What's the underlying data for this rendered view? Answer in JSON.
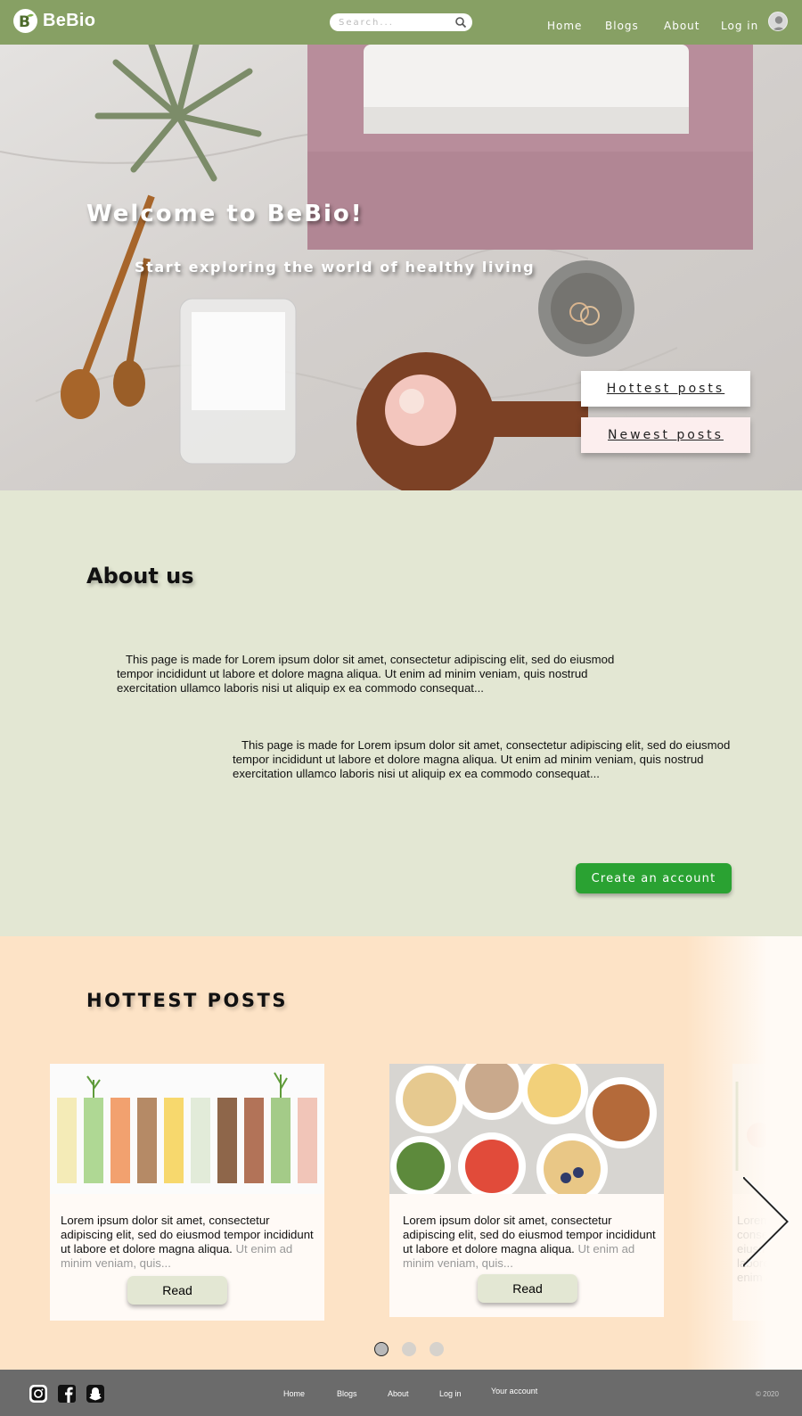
{
  "navbar": {
    "brand": "BeBio",
    "search_placeholder": "Search...",
    "links": [
      "Home",
      "Blogs",
      "About",
      "Log in"
    ],
    "icons": {
      "search": "search-icon",
      "avatar": "user-avatar-icon",
      "logo": "bebio-logo-icon"
    }
  },
  "hero": {
    "title": "Welcome to BeBio!",
    "subtitle": "Start exploring the world of healthy living",
    "buttons": {
      "hottest": "Hottest posts",
      "newest": "Newest posts"
    }
  },
  "about": {
    "title": "About us",
    "paragraphs": [
      "This page is made for Lorem ipsum dolor sit amet, consectetur adipiscing elit, sed do eiusmod tempor incididunt ut labore et dolore magna aliqua. Ut enim ad minim veniam, quis nostrud exercitation ullamco laboris nisi ut aliquip ex ea commodo consequat...",
      "This page is made for Lorem ipsum dolor sit amet, consectetur adipiscing elit, sed do eiusmod tempor incididunt ut labore et dolore magna aliqua. Ut enim ad minim veniam, quis nostrud exercitation ullamco laboris nisi ut aliquip ex ea commodo consequat..."
    ],
    "cta": "Create an account"
  },
  "hottest": {
    "title": "HOTTEST POSTS",
    "posts": [
      {
        "text": "Lorem ipsum dolor sit amet, consectetur adipiscing elit, sed do eiusmod tempor incididunt ut labore et dolore magna aliqua.",
        "faded": "Ut enim ad minim veniam, quis...",
        "button": "Read"
      },
      {
        "text": "Lorem ipsum dolor sit amet, consectetur adipiscing elit, sed do eiusmod tempor incididunt ut labore et dolore magna aliqua.",
        "faded": "Ut enim ad minim veniam, quis...",
        "button": "Read"
      },
      {
        "text": "Lorem consect eiusmo labore e enim ad"
      }
    ],
    "active_page": 1,
    "page_count": 3
  },
  "footer": {
    "links": [
      "Home",
      "Blogs",
      "About",
      "Log in",
      "Your account"
    ],
    "copyright": "© 2020",
    "social": [
      "instagram-icon",
      "facebook-icon",
      "snapchat-icon"
    ]
  },
  "colors": {
    "navbar": "#87a064",
    "about_bg": "#e3e7d3",
    "hottest_bg": "#fde3c6",
    "cta_green": "#2aa232",
    "footer": "#6b6b6b"
  }
}
